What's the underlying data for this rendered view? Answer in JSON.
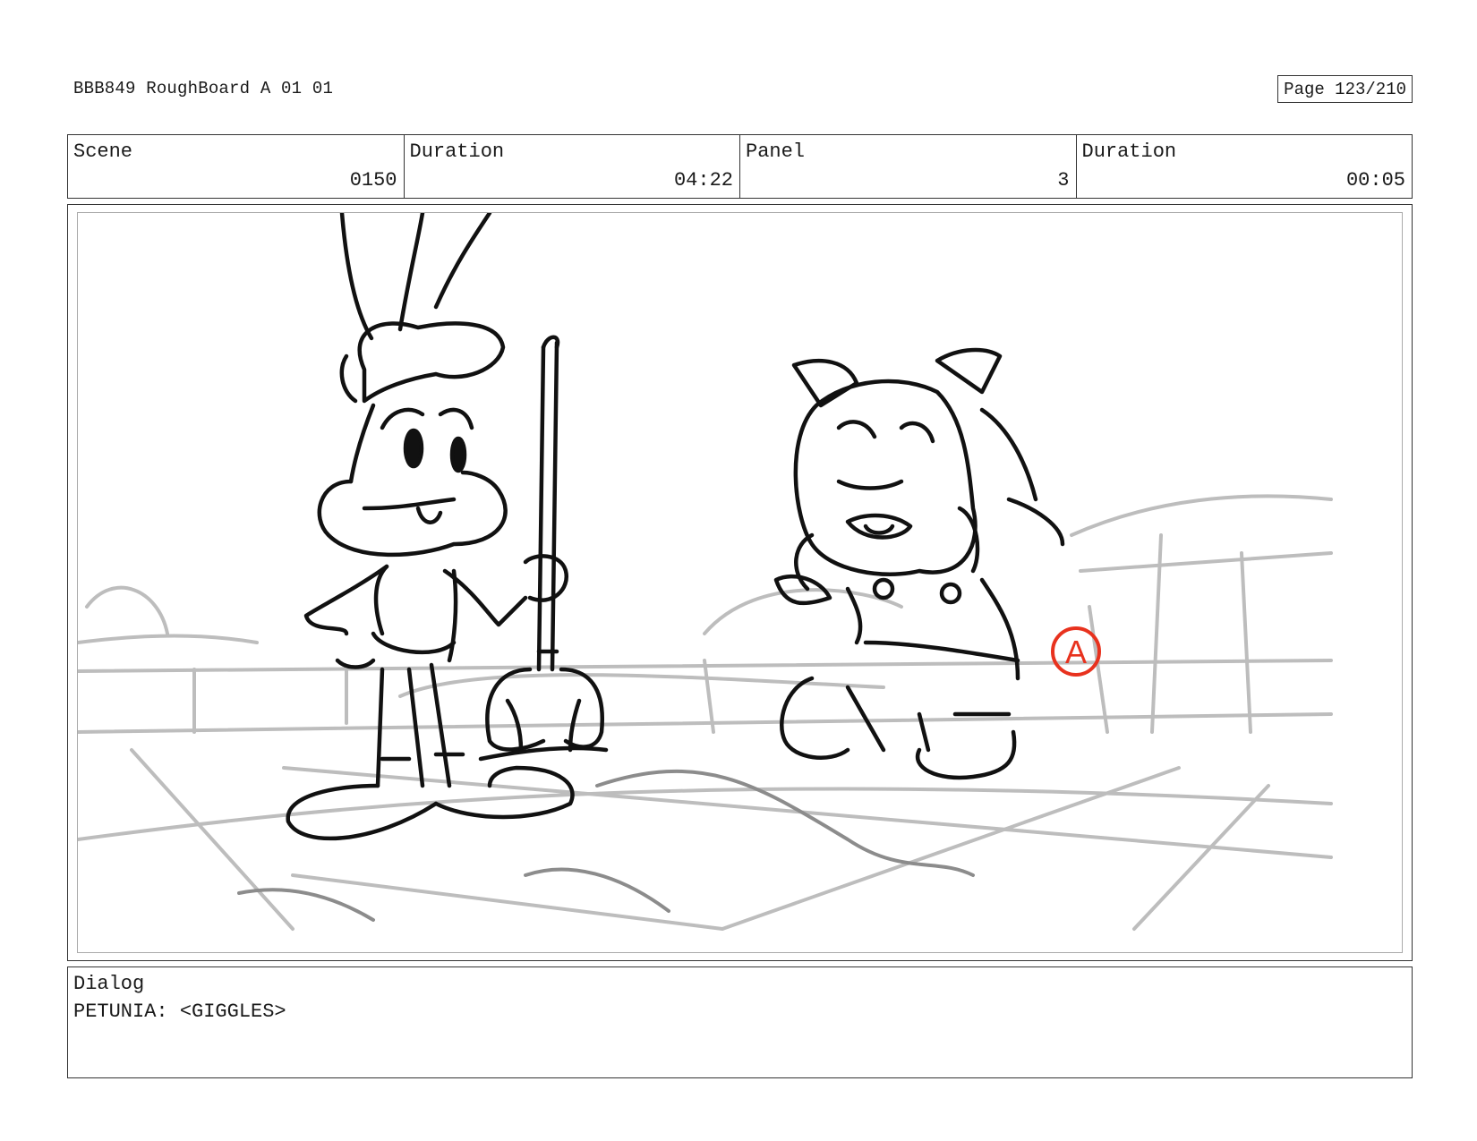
{
  "header": {
    "doc_title": "BBB849 RoughBoard A 01 01",
    "page_number": "Page 123/210"
  },
  "info": {
    "scene_label": "Scene",
    "scene_value": "0150",
    "scene_duration_label": "Duration",
    "scene_duration_value": "04:22",
    "panel_label": "Panel",
    "panel_value": "3",
    "panel_duration_label": "Duration",
    "panel_duration_value": "00:05"
  },
  "panel": {
    "annotation_marker": "A",
    "marker_color": "#e8321e"
  },
  "dialog": {
    "label": "Dialog",
    "text": "PETUNIA: <GIGGLES>"
  }
}
